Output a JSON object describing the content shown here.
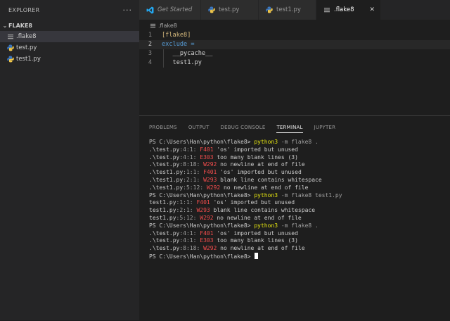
{
  "explorer": {
    "title": "EXPLORER",
    "more": "···",
    "folder": "FLAKE8",
    "files": [
      {
        "name": ".flake8",
        "icon": "settings-file-icon",
        "active": true
      },
      {
        "name": "test.py",
        "icon": "python-file-icon",
        "active": false
      },
      {
        "name": "test1.py",
        "icon": "python-file-icon",
        "active": false
      }
    ]
  },
  "tabs": [
    {
      "label": "Get Started",
      "icon": "vscode-logo-icon",
      "active": false,
      "italic": true
    },
    {
      "label": "test.py",
      "icon": "python-file-icon",
      "active": false,
      "italic": false
    },
    {
      "label": "test1.py",
      "icon": "python-file-icon",
      "active": false,
      "italic": false
    },
    {
      "label": ".flake8",
      "icon": "settings-file-icon",
      "active": true,
      "italic": false
    }
  ],
  "breadcrumb": ".flake8",
  "editor": {
    "lines": [
      {
        "num": "1",
        "text": "[flake8]",
        "color": "#d7ba7d",
        "indent": false,
        "current": false
      },
      {
        "num": "2",
        "text": "exclude =",
        "color": "#569cd6",
        "indent": false,
        "current": true
      },
      {
        "num": "3",
        "text": "   __pycache__",
        "color": "#d4d4d4",
        "indent": true,
        "current": false
      },
      {
        "num": "4",
        "text": "   test1.py",
        "color": "#d4d4d4",
        "indent": true,
        "current": false
      }
    ]
  },
  "panel": {
    "tabs": [
      "PROBLEMS",
      "OUTPUT",
      "DEBUG CONSOLE",
      "TERMINAL",
      "JUPYTER"
    ],
    "active_tab": "TERMINAL"
  },
  "terminal": {
    "lines": [
      {
        "segments": [
          {
            "t": "PS C:\\Users\\Han\\python\\flake8> ",
            "c": "ps"
          },
          {
            "t": "python3",
            "c": "cmd"
          },
          {
            "t": " -m flake8 .",
            "c": "dim"
          }
        ]
      },
      {
        "segments": [
          {
            "t": ".\\test.py",
            "c": "loc"
          },
          {
            "t": ":4:1: ",
            "c": "dim"
          },
          {
            "t": "F401",
            "c": "code-err"
          },
          {
            "t": " 'os' imported but unused",
            "c": "loc"
          }
        ]
      },
      {
        "segments": [
          {
            "t": ".\\test.py",
            "c": "loc"
          },
          {
            "t": ":4:1: ",
            "c": "dim"
          },
          {
            "t": "E303",
            "c": "code-err"
          },
          {
            "t": " too many blank lines (3)",
            "c": "loc"
          }
        ]
      },
      {
        "segments": [
          {
            "t": ".\\test.py",
            "c": "loc"
          },
          {
            "t": ":8:18: ",
            "c": "dim"
          },
          {
            "t": "W292",
            "c": "code-err"
          },
          {
            "t": " no newline at end of file",
            "c": "loc"
          }
        ]
      },
      {
        "segments": [
          {
            "t": ".\\test1.py",
            "c": "loc"
          },
          {
            "t": ":1:1: ",
            "c": "dim"
          },
          {
            "t": "F401",
            "c": "code-err"
          },
          {
            "t": " 'os' imported but unused",
            "c": "loc"
          }
        ]
      },
      {
        "segments": [
          {
            "t": ".\\test1.py",
            "c": "loc"
          },
          {
            "t": ":2:1: ",
            "c": "dim"
          },
          {
            "t": "W293",
            "c": "code-err"
          },
          {
            "t": " blank line contains whitespace",
            "c": "loc"
          }
        ]
      },
      {
        "segments": [
          {
            "t": ".\\test1.py",
            "c": "loc"
          },
          {
            "t": ":5:12: ",
            "c": "dim"
          },
          {
            "t": "W292",
            "c": "code-err"
          },
          {
            "t": " no newline at end of file",
            "c": "loc"
          }
        ]
      },
      {
        "segments": [
          {
            "t": "PS C:\\Users\\Han\\python\\flake8> ",
            "c": "ps"
          },
          {
            "t": "python3",
            "c": "cmd"
          },
          {
            "t": " -m flake8 test1.py",
            "c": "dim"
          }
        ]
      },
      {
        "segments": [
          {
            "t": "test1.py",
            "c": "loc"
          },
          {
            "t": ":1:1: ",
            "c": "dim"
          },
          {
            "t": "F401",
            "c": "code-err"
          },
          {
            "t": " 'os' imported but unused",
            "c": "loc"
          }
        ]
      },
      {
        "segments": [
          {
            "t": "test1.py",
            "c": "loc"
          },
          {
            "t": ":2:1: ",
            "c": "dim"
          },
          {
            "t": "W293",
            "c": "code-err"
          },
          {
            "t": " blank line contains whitespace",
            "c": "loc"
          }
        ]
      },
      {
        "segments": [
          {
            "t": "test1.py",
            "c": "loc"
          },
          {
            "t": ":5:12: ",
            "c": "dim"
          },
          {
            "t": "W292",
            "c": "code-err"
          },
          {
            "t": " no newline at end of file",
            "c": "loc"
          }
        ]
      },
      {
        "segments": [
          {
            "t": "PS C:\\Users\\Han\\python\\flake8> ",
            "c": "ps"
          },
          {
            "t": "python3",
            "c": "cmd"
          },
          {
            "t": " -m flake8 .",
            "c": "dim"
          }
        ]
      },
      {
        "segments": [
          {
            "t": ".\\test.py",
            "c": "loc"
          },
          {
            "t": ":4:1: ",
            "c": "dim"
          },
          {
            "t": "F401",
            "c": "code-err"
          },
          {
            "t": " 'os' imported but unused",
            "c": "loc"
          }
        ]
      },
      {
        "segments": [
          {
            "t": ".\\test.py",
            "c": "loc"
          },
          {
            "t": ":4:1: ",
            "c": "dim"
          },
          {
            "t": "E303",
            "c": "code-err"
          },
          {
            "t": " too many blank lines (3)",
            "c": "loc"
          }
        ]
      },
      {
        "segments": [
          {
            "t": ".\\test.py",
            "c": "loc"
          },
          {
            "t": ":8:18: ",
            "c": "dim"
          },
          {
            "t": "W292",
            "c": "code-err"
          },
          {
            "t": " no newline at end of file",
            "c": "loc"
          }
        ]
      },
      {
        "segments": [
          {
            "t": "PS C:\\Users\\Han\\python\\flake8> ",
            "c": "ps"
          }
        ],
        "cursor": true
      }
    ]
  },
  "colors": {
    "accent_python": "#3b78c2",
    "settings_icon": "#9e9e9e",
    "vscode_blue": "#23a9f2",
    "error_code": "#f14c4c",
    "command": "#e5e510"
  }
}
